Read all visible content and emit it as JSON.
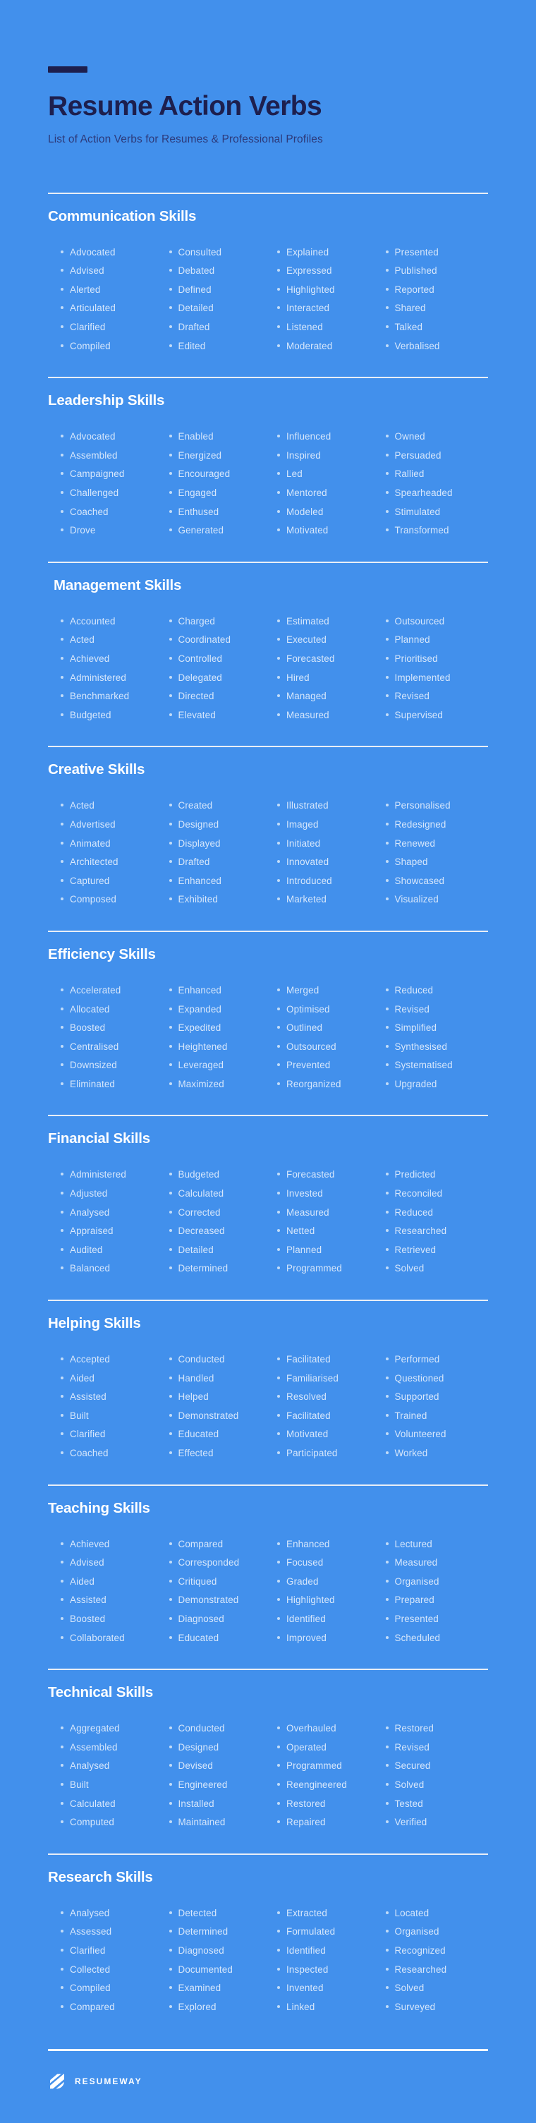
{
  "header": {
    "title": "Resume Action Verbs",
    "subtitle": "List of Action Verbs for Resumes & Professional Profiles"
  },
  "colors": {
    "background": "#4290ec",
    "title": "#1d1f4e",
    "section_title": "#ffffff",
    "verb_text": "#d7e7fb",
    "divider": "#e8eef7",
    "footer_divider": "#ffffff"
  },
  "sections": [
    {
      "title": "Communication Skills",
      "columns": [
        [
          "Advocated",
          "Advised",
          "Alerted",
          "Articulated",
          "Clarified",
          "Compiled"
        ],
        [
          "Consulted",
          "Debated",
          "Defined",
          "Detailed",
          "Drafted",
          "Edited"
        ],
        [
          "Explained",
          "Expressed",
          "Highlighted",
          "Interacted",
          "Listened",
          "Moderated"
        ],
        [
          "Presented",
          "Published",
          "Reported",
          "Shared",
          "Talked",
          "Verbalised"
        ]
      ]
    },
    {
      "title": "Leadership Skills",
      "columns": [
        [
          "Advocated",
          "Assembled",
          "Campaigned",
          "Challenged",
          "Coached",
          "Drove"
        ],
        [
          "Enabled",
          "Energized",
          "Encouraged",
          "Engaged",
          "Enthused",
          "Generated"
        ],
        [
          "Influenced",
          "Inspired",
          "Led",
          "Mentored",
          "Modeled",
          "Motivated"
        ],
        [
          "Owned",
          "Persuaded",
          "Rallied",
          "Spearheaded",
          "Stimulated",
          "Transformed"
        ]
      ]
    },
    {
      "title": "Management Skills",
      "columns": [
        [
          "Accounted",
          "Acted",
          "Achieved",
          "Administered",
          "Benchmarked",
          "Budgeted"
        ],
        [
          "Charged",
          "Coordinated",
          "Controlled",
          "Delegated",
          "Directed",
          "Elevated"
        ],
        [
          "Estimated",
          "Executed",
          "Forecasted",
          "Hired",
          "Managed",
          "Measured"
        ],
        [
          "Outsourced",
          "Planned",
          "Prioritised",
          "Implemented",
          "Revised",
          "Supervised"
        ]
      ]
    },
    {
      "title": "Creative Skills",
      "columns": [
        [
          "Acted",
          "Advertised",
          "Animated",
          "Architected",
          "Captured",
          "Composed"
        ],
        [
          "Created",
          "Designed",
          "Displayed",
          "Drafted",
          "Enhanced",
          "Exhibited"
        ],
        [
          "Illustrated",
          "Imaged",
          "Initiated",
          "Innovated",
          "Introduced",
          "Marketed"
        ],
        [
          "Personalised",
          "Redesigned",
          "Renewed",
          "Shaped",
          "Showcased",
          "Visualized"
        ]
      ]
    },
    {
      "title": "Efficiency Skills",
      "columns": [
        [
          "Accelerated",
          "Allocated",
          "Boosted",
          "Centralised",
          "Downsized",
          "Eliminated"
        ],
        [
          "Enhanced",
          "Expanded",
          "Expedited",
          "Heightened",
          "Leveraged",
          "Maximized"
        ],
        [
          "Merged",
          "Optimised",
          "Outlined",
          "Outsourced",
          "Prevented",
          "Reorganized"
        ],
        [
          "Reduced",
          "Revised",
          "Simplified",
          "Synthesised",
          "Systematised",
          "Upgraded"
        ]
      ]
    },
    {
      "title": "Financial Skills",
      "columns": [
        [
          "Administered",
          "Adjusted",
          "Analysed",
          "Appraised",
          "Audited",
          "Balanced"
        ],
        [
          "Budgeted",
          "Calculated",
          "Corrected",
          "Decreased",
          "Detailed",
          "Determined"
        ],
        [
          "Forecasted",
          "Invested",
          "Measured",
          "Netted",
          "Planned",
          "Programmed"
        ],
        [
          "Predicted",
          "Reconciled",
          "Reduced",
          "Researched",
          "Retrieved",
          "Solved"
        ]
      ]
    },
    {
      "title": "Helping Skills",
      "columns": [
        [
          "Accepted",
          "Aided",
          "Assisted",
          "Built",
          "Clarified",
          "Coached"
        ],
        [
          "Conducted",
          "Handled",
          "Helped",
          "Demonstrated",
          "Educated",
          "Effected"
        ],
        [
          "Facilitated",
          "Familiarised",
          "Resolved",
          "Facilitated",
          "Motivated",
          "Participated"
        ],
        [
          "Performed",
          "Questioned",
          "Supported",
          "Trained",
          "Volunteered",
          "Worked"
        ]
      ]
    },
    {
      "title": "Teaching Skills",
      "columns": [
        [
          "Achieved",
          "Advised",
          "Aided",
          "Assisted",
          "Boosted",
          "Collaborated"
        ],
        [
          "Compared",
          "Corresponded",
          "Critiqued",
          "Demonstrated",
          "Diagnosed",
          "Educated"
        ],
        [
          "Enhanced",
          "Focused",
          "Graded",
          "Highlighted",
          "Identified",
          "Improved"
        ],
        [
          "Lectured",
          "Measured",
          "Organised",
          "Prepared",
          "Presented",
          "Scheduled"
        ]
      ]
    },
    {
      "title": "Technical Skills",
      "columns": [
        [
          "Aggregated",
          "Assembled",
          "Analysed",
          "Built",
          "Calculated",
          "Computed"
        ],
        [
          "Conducted",
          "Designed",
          "Devised",
          "Engineered",
          "Installed",
          "Maintained"
        ],
        [
          "Overhauled",
          "Operated",
          "Programmed",
          "Reengineered",
          "Restored",
          "Repaired"
        ],
        [
          "Restored",
          "Revised",
          "Secured",
          "Solved",
          "Tested",
          "Verified"
        ]
      ]
    },
    {
      "title": "Research Skills",
      "columns": [
        [
          "Analysed",
          "Assessed",
          "Clarified",
          "Collected",
          "Compiled",
          "Compared"
        ],
        [
          "Detected",
          "Determined",
          "Diagnosed",
          "Documented",
          "Examined",
          "Explored"
        ],
        [
          "Extracted",
          "Formulated",
          "Identified",
          "Inspected",
          "Invented",
          "Linked"
        ],
        [
          "Located",
          "Organised",
          "Recognized",
          "Researched",
          "Solved",
          "Surveyed"
        ]
      ]
    }
  ],
  "footer": {
    "brand_name": "RESUMEWAY",
    "brand_icon": "resumeway-logo-icon"
  }
}
